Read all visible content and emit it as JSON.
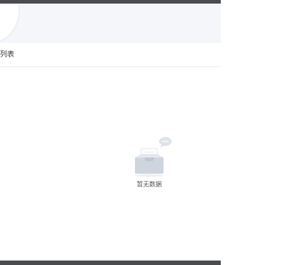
{
  "page": {
    "list_title": "列表",
    "empty_text": "暂无数据"
  },
  "icons": {
    "empty": "empty-inbox-icon"
  },
  "colors": {
    "frame": "#4a4c50",
    "header_bg": "#f4f6f9",
    "text": "#333333",
    "muted": "#555555"
  }
}
